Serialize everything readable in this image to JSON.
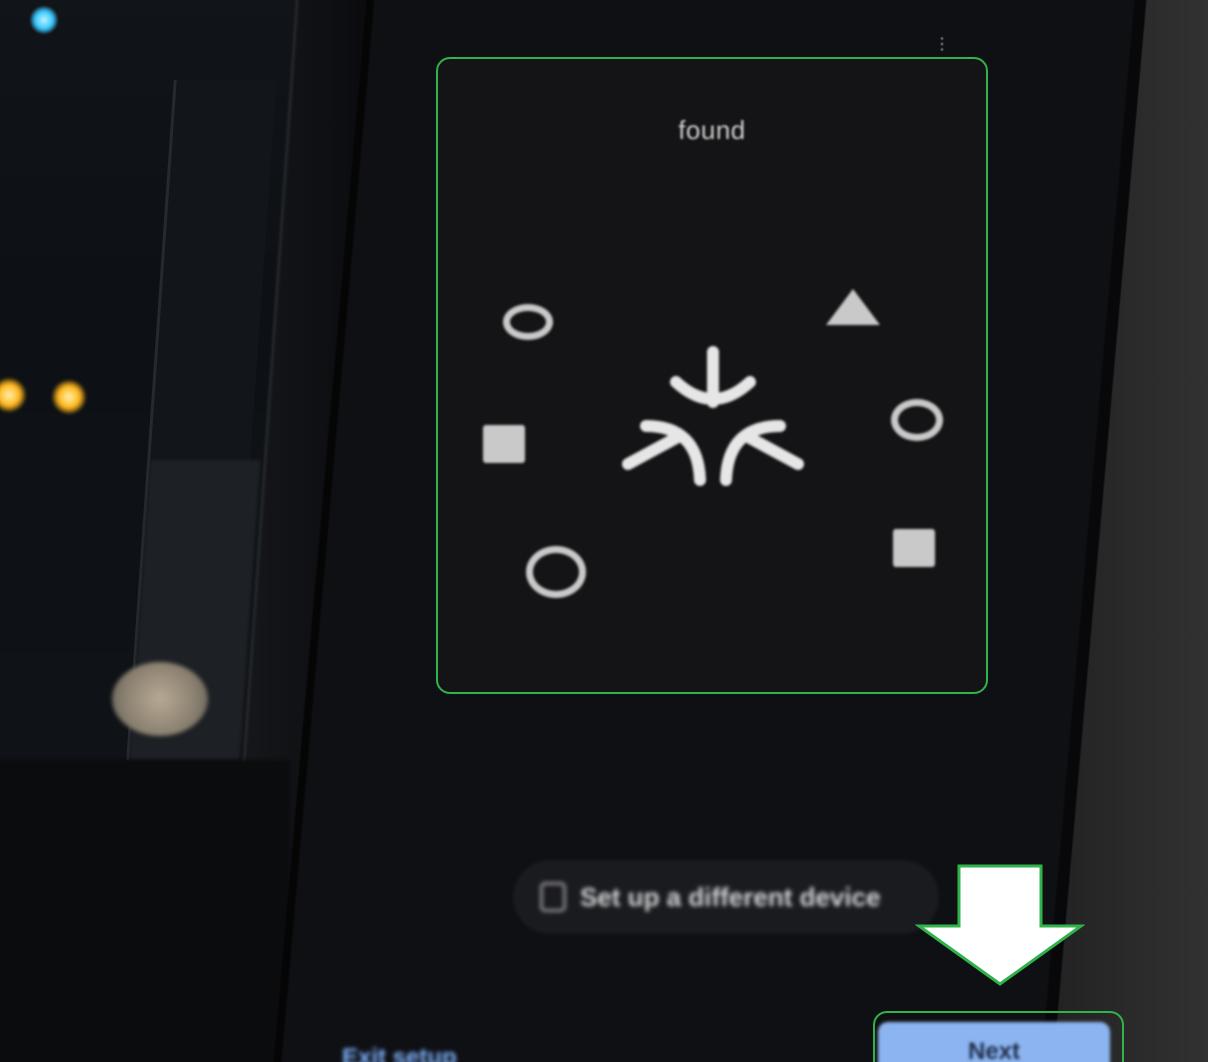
{
  "panel": {
    "title": "found",
    "shapes": [
      {
        "kind": "ring",
        "name": "circle-shape-top-left"
      },
      {
        "kind": "triangle",
        "name": "triangle-shape-top-right"
      },
      {
        "kind": "square",
        "name": "square-shape-left"
      },
      {
        "kind": "ring",
        "name": "circle-shape-right"
      },
      {
        "kind": "ring",
        "name": "circle-shape-bottom-left"
      },
      {
        "kind": "square",
        "name": "square-shape-bottom-right"
      }
    ],
    "center_icon": "matter-logo-icon"
  },
  "actions": {
    "alt_device_label": "Set up a different device",
    "alt_device_icon": "device-icon",
    "exit_label": "Exit setup",
    "next_label": "Next"
  },
  "annotations": {
    "highlight_color": "#2fb34a",
    "arrow_color": "#ffffff"
  },
  "colors": {
    "screen_bg": "#141416",
    "shape_color": "#c9c9c9",
    "primary_button": "#8bb4f0",
    "link_color": "#7fb2ff"
  },
  "header": {
    "menu_icon": "overflow-menu-icon"
  }
}
